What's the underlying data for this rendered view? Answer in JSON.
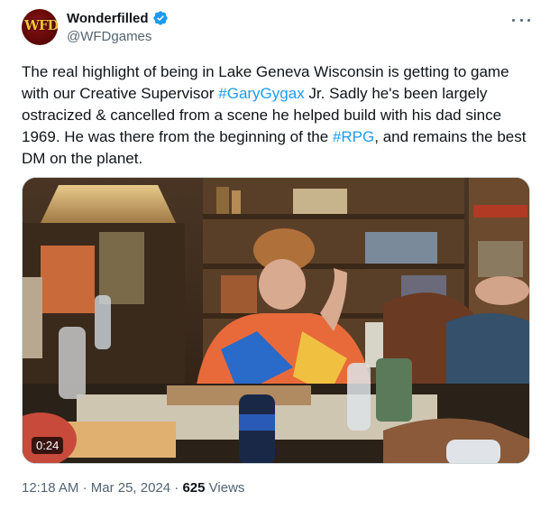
{
  "account": {
    "display_name": "Wonderfilled",
    "handle": "@WFDgames",
    "avatar_text": "WFD",
    "verified": true
  },
  "tweet": {
    "text_parts": {
      "p1": "The real highlight of being in Lake Geneva Wisconsin is getting to game with our Creative Supervisor ",
      "tag1": "#GaryGygax",
      "p2": " Jr. Sadly he's been largely ostracized & cancelled from a scene he helped build with his dad since 1969. He was there from the beginning of the ",
      "tag2": "#RPG",
      "p3": ", and remains the best DM on the planet."
    }
  },
  "media": {
    "type": "video",
    "duration": "0:24"
  },
  "meta": {
    "time": "12:18 AM",
    "separator": "·",
    "date": "Mar 25, 2024",
    "views_count": "625",
    "views_label": "Views"
  },
  "colors": {
    "link": "#1d9bf0",
    "text": "#0f1419",
    "muted": "#536471",
    "verified": "#1d9bf0"
  }
}
